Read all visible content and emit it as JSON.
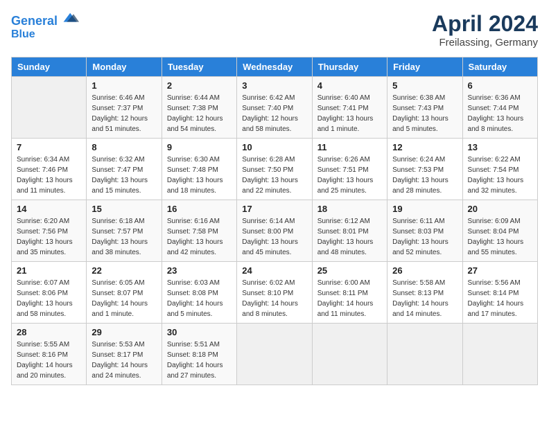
{
  "header": {
    "logo_line1": "General",
    "logo_line2": "Blue",
    "month_title": "April 2024",
    "location": "Freilassing, Germany"
  },
  "days_of_week": [
    "Sunday",
    "Monday",
    "Tuesday",
    "Wednesday",
    "Thursday",
    "Friday",
    "Saturday"
  ],
  "weeks": [
    [
      {
        "day": "",
        "info": ""
      },
      {
        "day": "1",
        "info": "Sunrise: 6:46 AM\nSunset: 7:37 PM\nDaylight: 12 hours\nand 51 minutes."
      },
      {
        "day": "2",
        "info": "Sunrise: 6:44 AM\nSunset: 7:38 PM\nDaylight: 12 hours\nand 54 minutes."
      },
      {
        "day": "3",
        "info": "Sunrise: 6:42 AM\nSunset: 7:40 PM\nDaylight: 12 hours\nand 58 minutes."
      },
      {
        "day": "4",
        "info": "Sunrise: 6:40 AM\nSunset: 7:41 PM\nDaylight: 13 hours\nand 1 minute."
      },
      {
        "day": "5",
        "info": "Sunrise: 6:38 AM\nSunset: 7:43 PM\nDaylight: 13 hours\nand 5 minutes."
      },
      {
        "day": "6",
        "info": "Sunrise: 6:36 AM\nSunset: 7:44 PM\nDaylight: 13 hours\nand 8 minutes."
      }
    ],
    [
      {
        "day": "7",
        "info": "Sunrise: 6:34 AM\nSunset: 7:46 PM\nDaylight: 13 hours\nand 11 minutes."
      },
      {
        "day": "8",
        "info": "Sunrise: 6:32 AM\nSunset: 7:47 PM\nDaylight: 13 hours\nand 15 minutes."
      },
      {
        "day": "9",
        "info": "Sunrise: 6:30 AM\nSunset: 7:48 PM\nDaylight: 13 hours\nand 18 minutes."
      },
      {
        "day": "10",
        "info": "Sunrise: 6:28 AM\nSunset: 7:50 PM\nDaylight: 13 hours\nand 22 minutes."
      },
      {
        "day": "11",
        "info": "Sunrise: 6:26 AM\nSunset: 7:51 PM\nDaylight: 13 hours\nand 25 minutes."
      },
      {
        "day": "12",
        "info": "Sunrise: 6:24 AM\nSunset: 7:53 PM\nDaylight: 13 hours\nand 28 minutes."
      },
      {
        "day": "13",
        "info": "Sunrise: 6:22 AM\nSunset: 7:54 PM\nDaylight: 13 hours\nand 32 minutes."
      }
    ],
    [
      {
        "day": "14",
        "info": "Sunrise: 6:20 AM\nSunset: 7:56 PM\nDaylight: 13 hours\nand 35 minutes."
      },
      {
        "day": "15",
        "info": "Sunrise: 6:18 AM\nSunset: 7:57 PM\nDaylight: 13 hours\nand 38 minutes."
      },
      {
        "day": "16",
        "info": "Sunrise: 6:16 AM\nSunset: 7:58 PM\nDaylight: 13 hours\nand 42 minutes."
      },
      {
        "day": "17",
        "info": "Sunrise: 6:14 AM\nSunset: 8:00 PM\nDaylight: 13 hours\nand 45 minutes."
      },
      {
        "day": "18",
        "info": "Sunrise: 6:12 AM\nSunset: 8:01 PM\nDaylight: 13 hours\nand 48 minutes."
      },
      {
        "day": "19",
        "info": "Sunrise: 6:11 AM\nSunset: 8:03 PM\nDaylight: 13 hours\nand 52 minutes."
      },
      {
        "day": "20",
        "info": "Sunrise: 6:09 AM\nSunset: 8:04 PM\nDaylight: 13 hours\nand 55 minutes."
      }
    ],
    [
      {
        "day": "21",
        "info": "Sunrise: 6:07 AM\nSunset: 8:06 PM\nDaylight: 13 hours\nand 58 minutes."
      },
      {
        "day": "22",
        "info": "Sunrise: 6:05 AM\nSunset: 8:07 PM\nDaylight: 14 hours\nand 1 minute."
      },
      {
        "day": "23",
        "info": "Sunrise: 6:03 AM\nSunset: 8:08 PM\nDaylight: 14 hours\nand 5 minutes."
      },
      {
        "day": "24",
        "info": "Sunrise: 6:02 AM\nSunset: 8:10 PM\nDaylight: 14 hours\nand 8 minutes."
      },
      {
        "day": "25",
        "info": "Sunrise: 6:00 AM\nSunset: 8:11 PM\nDaylight: 14 hours\nand 11 minutes."
      },
      {
        "day": "26",
        "info": "Sunrise: 5:58 AM\nSunset: 8:13 PM\nDaylight: 14 hours\nand 14 minutes."
      },
      {
        "day": "27",
        "info": "Sunrise: 5:56 AM\nSunset: 8:14 PM\nDaylight: 14 hours\nand 17 minutes."
      }
    ],
    [
      {
        "day": "28",
        "info": "Sunrise: 5:55 AM\nSunset: 8:16 PM\nDaylight: 14 hours\nand 20 minutes."
      },
      {
        "day": "29",
        "info": "Sunrise: 5:53 AM\nSunset: 8:17 PM\nDaylight: 14 hours\nand 24 minutes."
      },
      {
        "day": "30",
        "info": "Sunrise: 5:51 AM\nSunset: 8:18 PM\nDaylight: 14 hours\nand 27 minutes."
      },
      {
        "day": "",
        "info": ""
      },
      {
        "day": "",
        "info": ""
      },
      {
        "day": "",
        "info": ""
      },
      {
        "day": "",
        "info": ""
      }
    ]
  ]
}
